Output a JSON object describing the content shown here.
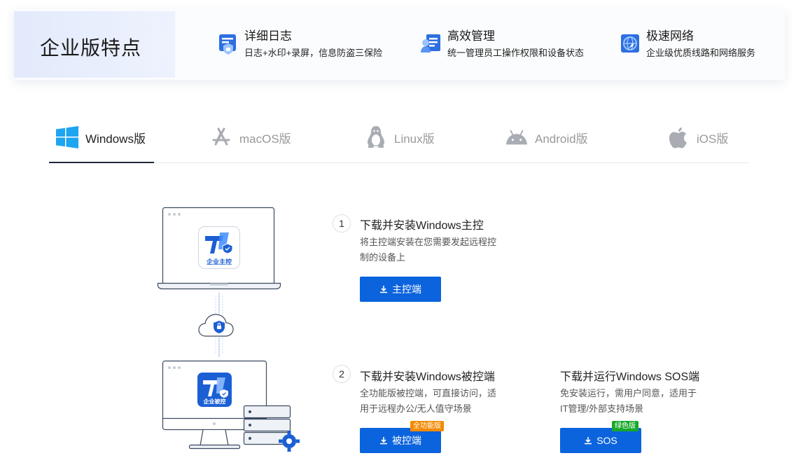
{
  "banner": {
    "title": "企业版特点",
    "features": [
      {
        "title": "详细日志",
        "desc": "日志+水印+录屏，信息防盗三保险",
        "icon": "log-shield-icon"
      },
      {
        "title": "高效管理",
        "desc": "统一管理员工操作权限和设备状态",
        "icon": "admin-management-icon"
      },
      {
        "title": "极速网络",
        "desc": "企业级优质线路和网络服务",
        "icon": "fast-network-icon"
      }
    ]
  },
  "tabs": [
    {
      "label": "Windows版",
      "icon": "windows-icon",
      "active": true
    },
    {
      "label": "macOS版",
      "icon": "app-store-icon",
      "active": false
    },
    {
      "label": "Linux版",
      "icon": "linux-penguin-icon",
      "active": false
    },
    {
      "label": "Android版",
      "icon": "android-icon",
      "active": false
    },
    {
      "label": "iOS版",
      "icon": "apple-icon",
      "active": false
    }
  ],
  "steps": {
    "controller": {
      "number": "1",
      "title": "下载并安装Windows主控",
      "desc": "将主控端安装在您需要发起远程控制的设备上",
      "button": "主控端",
      "app_label": "企业主控"
    },
    "controlled": {
      "number": "2",
      "title": "下载并安装Windows被控端",
      "desc": "全功能版被控端，可直接访问，适用于远程办公/无人值守场景",
      "button": "被控端",
      "tag": "全功能版",
      "app_label": "企业被控"
    },
    "sos": {
      "title": "下载并运行Windows SOS端",
      "desc": "免安装运行，需用户同意，适用于IT管理/外部支持场景",
      "button": "SOS",
      "tag": "绿色版"
    }
  },
  "colors": {
    "primary": "#0b63dd",
    "tag_orange": "#f28a00",
    "tag_green": "#17a829",
    "windows_blue": "#1ea5f0"
  }
}
